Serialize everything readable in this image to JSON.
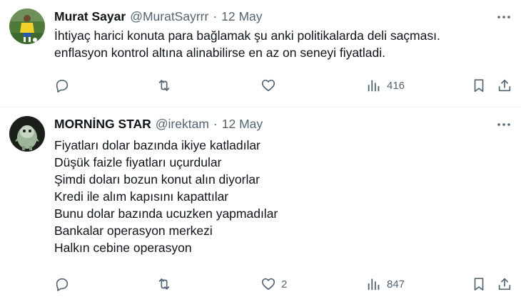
{
  "tweets": [
    {
      "display_name": "Murat Sayar",
      "handle": "@MuratSayrrr",
      "separator": "·",
      "date": "12 May",
      "avatar_icon": "soccer-player-avatar",
      "text_lines": [
        "İhtiyaç harici konuta para bağlamak şu anki politikalarda deli saçması.",
        "enflasyon kontrol altına alinabilirse en az on seneyi fiyatladi."
      ],
      "actions": {
        "replies": "",
        "reposts": "",
        "likes": "",
        "views": "416"
      }
    },
    {
      "display_name": "MORNİNG STAR",
      "handle": "@irektam",
      "separator": "·",
      "date": "12 May",
      "avatar_icon": "creature-avatar",
      "text_lines": [
        "Fiyatları dolar bazında ikiye katladılar",
        "Düşük faizle fiyatları uçurdular",
        "Şimdi doları bozun konut alın diyorlar",
        "Kredi ile alım kapısını kapattılar",
        "Bunu dolar bazında ucuzken yapmadılar",
        "Bankalar operasyon merkezi",
        "Halkın cebine operasyon"
      ],
      "actions": {
        "replies": "",
        "reposts": "",
        "likes": "2",
        "views": "847"
      }
    }
  ],
  "colors": {
    "text_primary": "#0f1419",
    "text_secondary": "#536471",
    "divider": "#eff3f4"
  }
}
